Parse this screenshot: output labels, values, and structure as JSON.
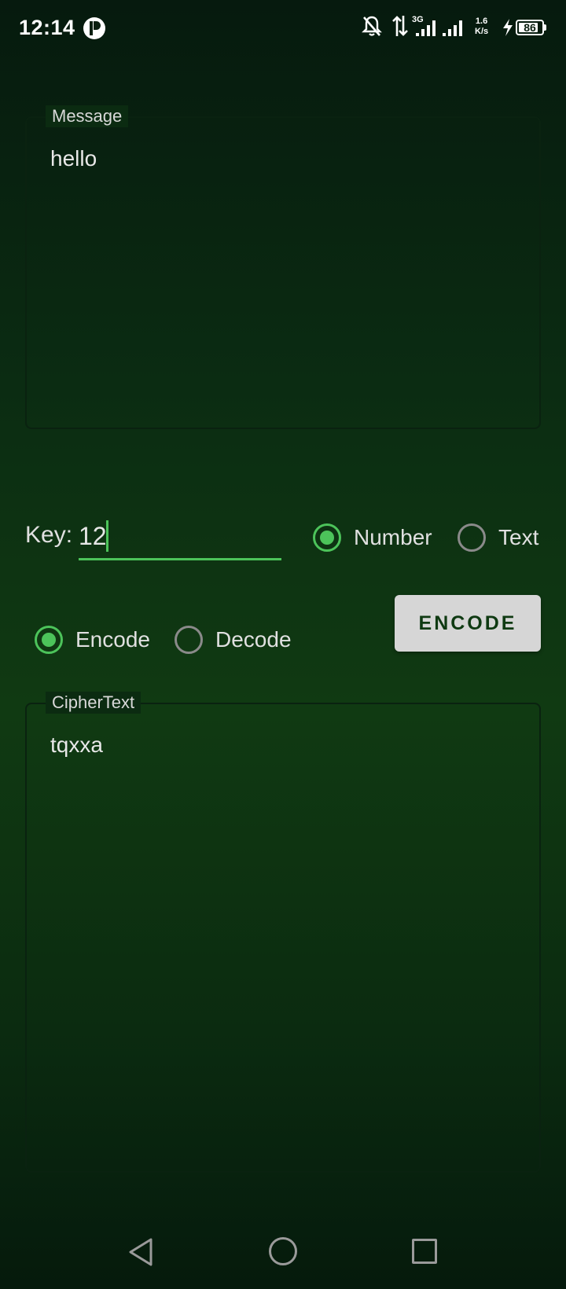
{
  "status_bar": {
    "time": "12:14",
    "network_type": "3G",
    "speed_value": "1.6",
    "speed_unit": "K/s",
    "battery": "86",
    "battery_level": 0.86
  },
  "message": {
    "label": "Message",
    "value": "hello"
  },
  "key": {
    "label": "Key:",
    "value": "12"
  },
  "key_type": {
    "options": [
      {
        "label": "Number",
        "checked": true
      },
      {
        "label": "Text",
        "checked": false
      }
    ]
  },
  "mode": {
    "options": [
      {
        "label": "Encode",
        "checked": true
      },
      {
        "label": "Decode",
        "checked": false
      }
    ]
  },
  "action_button": {
    "label": "ENCODE"
  },
  "ciphertext": {
    "label": "CipherText",
    "value": "tqxxa"
  },
  "colors": {
    "accent": "#4cc35a",
    "button_bg": "#d6d6d6",
    "button_text": "#0f3a12"
  },
  "nav_bar": {
    "icons": [
      "back-icon",
      "home-icon",
      "recent-apps-icon"
    ]
  }
}
